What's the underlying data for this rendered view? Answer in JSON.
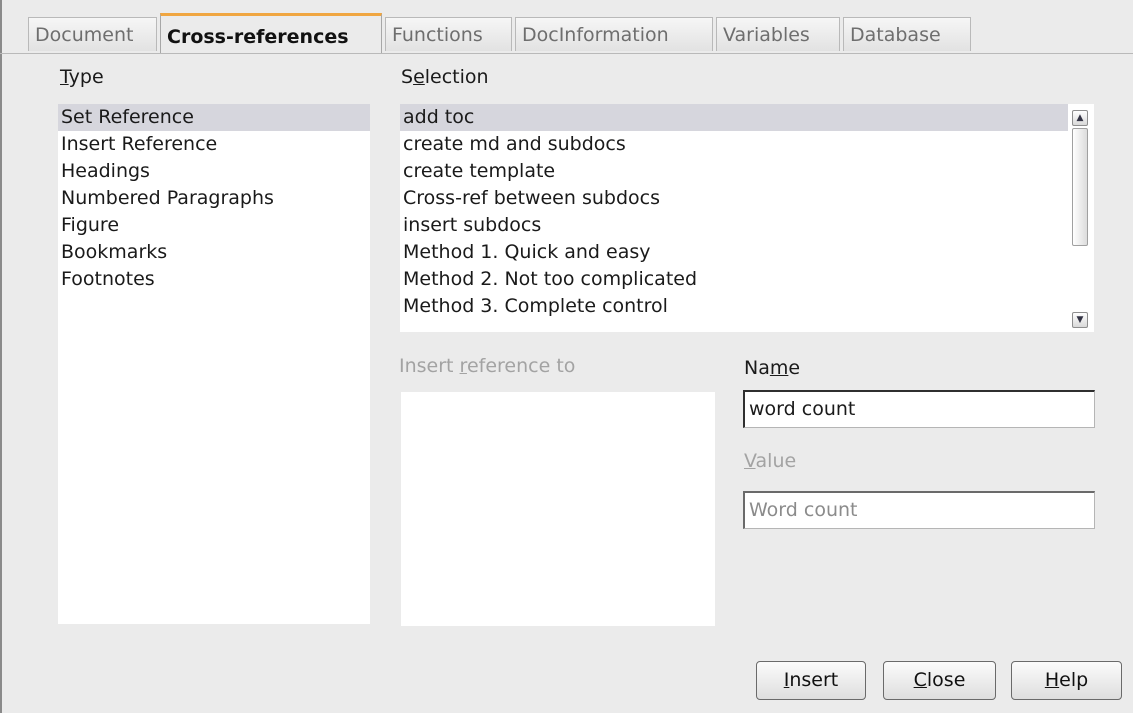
{
  "tabs": [
    {
      "label": "Document"
    },
    {
      "label": "Cross-references"
    },
    {
      "label": "Functions"
    },
    {
      "label": "DocInformation"
    },
    {
      "label": "Variables"
    },
    {
      "label": "Database"
    }
  ],
  "type_section": {
    "label_pre": "",
    "label_key": "T",
    "label_post": "ype",
    "items": [
      "Set Reference",
      "Insert Reference",
      "Headings",
      "Numbered Paragraphs",
      "Figure",
      "Bookmarks",
      "Footnotes"
    ],
    "selected": "Set Reference"
  },
  "selection_section": {
    "label_pre": "S",
    "label_key": "e",
    "label_post": "lection",
    "items": [
      "add toc",
      "create md and subdocs",
      "create template",
      "Cross-ref between subdocs",
      "insert subdocs",
      "Method 1. Quick and easy",
      "Method 2. Not too complicated",
      "Method 3. Complete control"
    ],
    "selected": "add toc"
  },
  "insert_reference_to": {
    "label_pre": "Insert ",
    "label_key": "r",
    "label_post": "eference to"
  },
  "name_field": {
    "label_pre": "Na",
    "label_key": "m",
    "label_post": "e",
    "value": "word count"
  },
  "value_field": {
    "label_pre": "",
    "label_key": "V",
    "label_post": "alue",
    "value": "Word count"
  },
  "buttons": {
    "insert": {
      "pre": "",
      "key": "I",
      "post": "nsert"
    },
    "close": {
      "pre": "",
      "key": "C",
      "post": "lose"
    },
    "help": {
      "pre": "",
      "key": "H",
      "post": "elp"
    }
  },
  "scroll_icons": {
    "up": "scroll-up-arrow",
    "down": "scroll-down-arrow"
  }
}
